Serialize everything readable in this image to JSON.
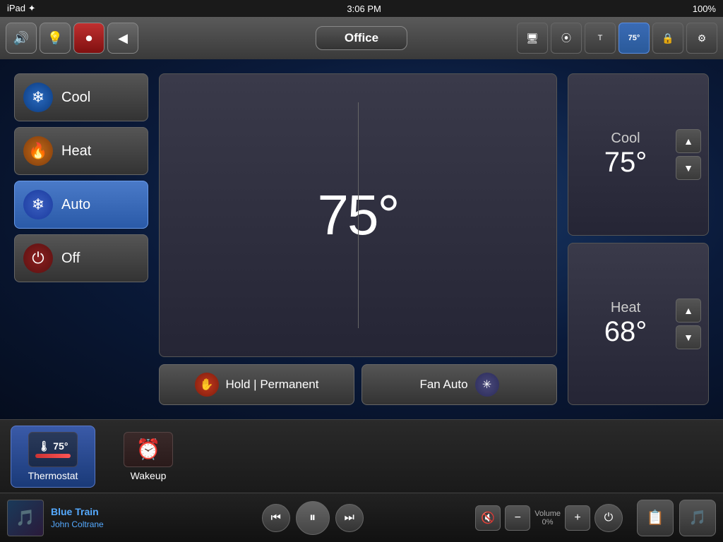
{
  "statusBar": {
    "left": "iPad ✦",
    "time": "3:06 PM",
    "battery": "100%"
  },
  "topNav": {
    "title": "Office",
    "buttons": {
      "sound": "🔊",
      "bulb": "💡",
      "record": "⏺",
      "back": "◀"
    },
    "rightButtons": [
      {
        "id": "monitor",
        "icon": "🖥",
        "active": false
      },
      {
        "id": "camera",
        "icon": "📷",
        "active": false
      },
      {
        "id": "therm",
        "icon": "T",
        "active": false
      },
      {
        "id": "temp-ctrl",
        "icon": "75°",
        "active": true
      },
      {
        "id": "lock",
        "icon": "🔒",
        "active": false
      },
      {
        "id": "gear",
        "icon": "⚙",
        "active": false
      }
    ]
  },
  "thermostat": {
    "currentTemp": "75°",
    "modes": [
      {
        "id": "cool",
        "label": "Cool",
        "icon": "❄",
        "iconClass": "cool",
        "active": false
      },
      {
        "id": "heat",
        "label": "Heat",
        "icon": "🔥",
        "iconClass": "heat",
        "active": false
      },
      {
        "id": "auto",
        "label": "Auto",
        "icon": "❄",
        "iconClass": "auto",
        "active": true
      },
      {
        "id": "off",
        "label": "Off",
        "icon": "⏻",
        "iconClass": "off",
        "active": false
      }
    ],
    "holdButton": "Hold | Permanent",
    "fanButton": "Fan Auto",
    "setPoints": [
      {
        "id": "cool-sp",
        "label": "Cool",
        "value": "75°",
        "upIcon": "▲",
        "downIcon": "▼"
      },
      {
        "id": "heat-sp",
        "label": "Heat",
        "value": "68°",
        "upIcon": "▲",
        "downIcon": "▼"
      }
    ]
  },
  "deviceTray": {
    "items": [
      {
        "id": "thermostat",
        "label": "Thermostat",
        "active": true,
        "tempVal": "75°"
      },
      {
        "id": "wakeup",
        "label": "Wakeup",
        "active": false
      }
    ]
  },
  "mediaBar": {
    "trackTitle": "Blue Train",
    "trackArtist": "John Coltrane",
    "volumeLabel": "Volume",
    "volumeValue": "0%",
    "controls": {
      "prev": "⏮",
      "pause": "⏸",
      "next": "⏭",
      "mute": "🔇",
      "volDown": "−",
      "volUp": "+",
      "power": "⏻"
    }
  }
}
